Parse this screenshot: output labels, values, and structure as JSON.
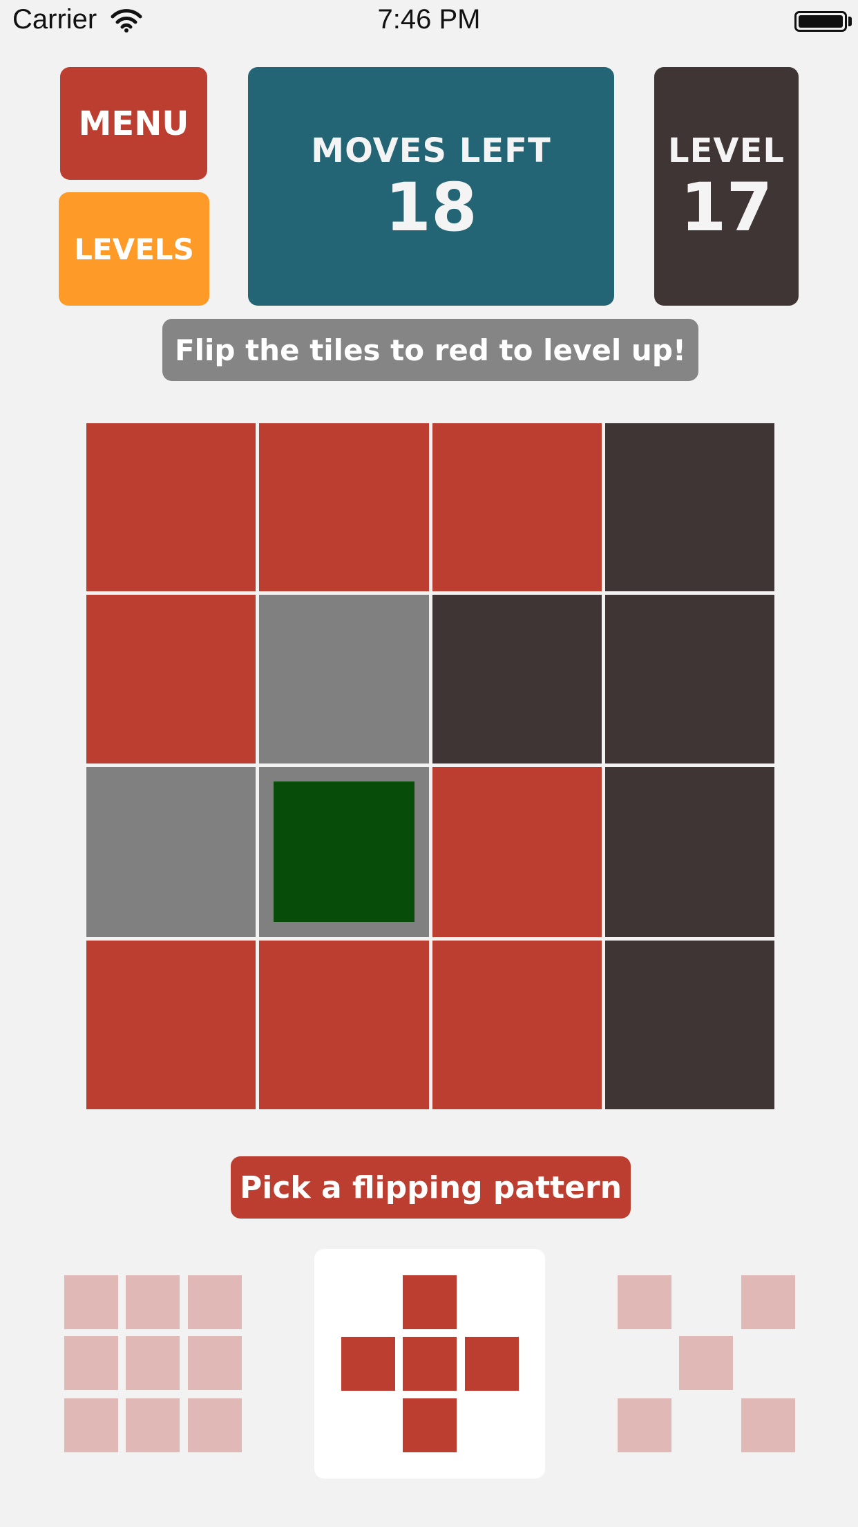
{
  "status_bar": {
    "carrier": "Carrier",
    "wifi_icon": "wifi-icon",
    "time": "7:46 PM",
    "battery_icon": "battery-icon",
    "battery_level": 1.0
  },
  "header": {
    "menu_label": "MENU",
    "levels_label": "LEVELS",
    "moves_left_label": "MOVES LEFT",
    "moves_left_value": "18",
    "level_label": "LEVEL",
    "level_value": "17"
  },
  "hint": "Flip the tiles to red to level up!",
  "board": {
    "rows": [
      [
        "red",
        "red",
        "red",
        "dark"
      ],
      [
        "red",
        "gray",
        "dark",
        "dark"
      ],
      [
        "gray",
        "gray-selected",
        "red",
        "dark"
      ],
      [
        "red",
        "red",
        "red",
        "dark"
      ]
    ]
  },
  "pattern_prompt": "Pick a flipping pattern",
  "patterns": [
    {
      "name": "full-3x3",
      "selected": false
    },
    {
      "name": "plus",
      "selected": true
    },
    {
      "name": "x-diagonals",
      "selected": false
    }
  ],
  "colors": {
    "background": "#f2f2f2",
    "menu": "#bb3e31",
    "levels": "#fd9a28",
    "moves_panel": "#236575",
    "level_panel": "#403535",
    "hint": "#858585",
    "tile_red": "#bb3e31",
    "tile_dark": "#403535",
    "tile_gray": "#808080",
    "selection_marker": "#084c0a",
    "pattern_faded": "#e0b8b5"
  }
}
